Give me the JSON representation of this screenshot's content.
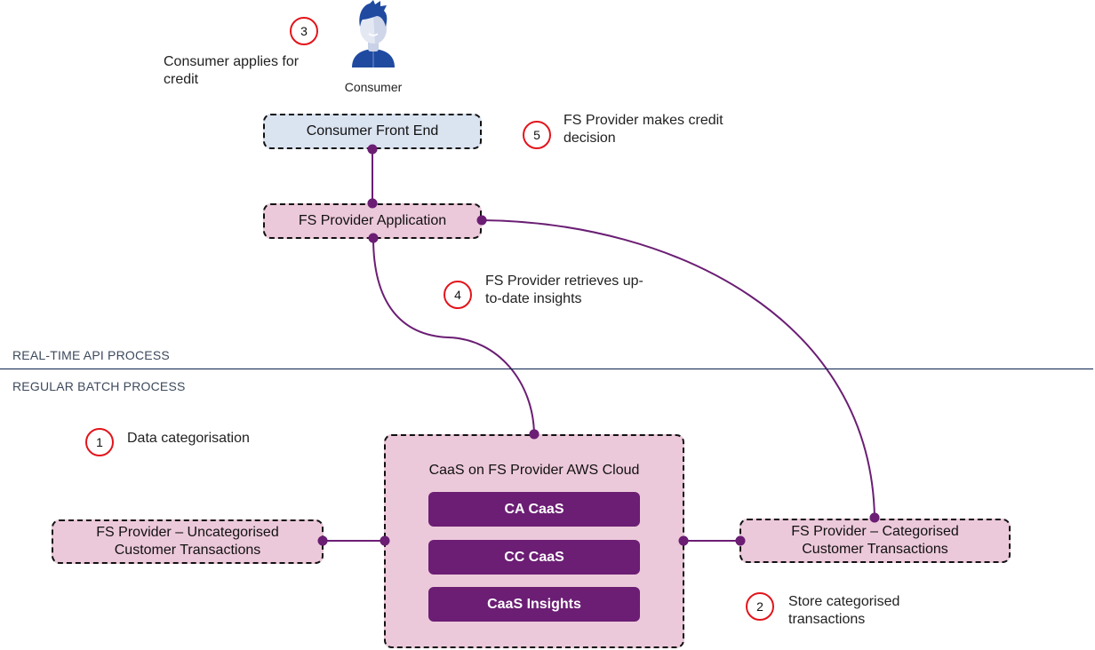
{
  "consumer": {
    "label": "Consumer",
    "icon": "person-icon"
  },
  "steps": [
    {
      "number": "1",
      "text": "Data categorisation"
    },
    {
      "number": "2",
      "text": "Store categorised transactions"
    },
    {
      "number": "3",
      "text": "Consumer applies for credit"
    },
    {
      "number": "4",
      "text": "FS Provider retrieves up-to-date insights"
    },
    {
      "number": "5",
      "text": "FS Provider makes credit decision"
    }
  ],
  "step_lines": {
    "s1": [
      "Data categorisation"
    ],
    "s2": [
      "Store categorised",
      "transactions"
    ],
    "s3": [
      "Consumer applies for",
      "credit"
    ],
    "s4": [
      "FS Provider retrieves up-",
      "to-date insights"
    ],
    "s5": [
      "FS Provider makes credit",
      "decision"
    ]
  },
  "nodes": {
    "consumer_front_end": "Consumer Front End",
    "fs_provider_application": "FS Provider Application",
    "uncategorised": [
      "FS Provider – Uncategorised",
      "Customer Transactions"
    ],
    "categorised": [
      "FS Provider – Categorised",
      "Customer Transactions"
    ],
    "caas_cloud": {
      "title": "CaaS on FS Provider AWS Cloud",
      "services": [
        "CA CaaS",
        "CC CaaS",
        "CaaS Insights"
      ]
    }
  },
  "sections": {
    "realtime": "REAL-TIME API PROCESS",
    "batch": "REGULAR BATCH PROCESS"
  },
  "colors": {
    "connector": "#6b1e74",
    "step_ring": "#e3141b",
    "divider": "#0d2350",
    "blue_box": "#dae3f0",
    "pink_box": "#ecc9da",
    "service_fill": "#6b1e74"
  }
}
